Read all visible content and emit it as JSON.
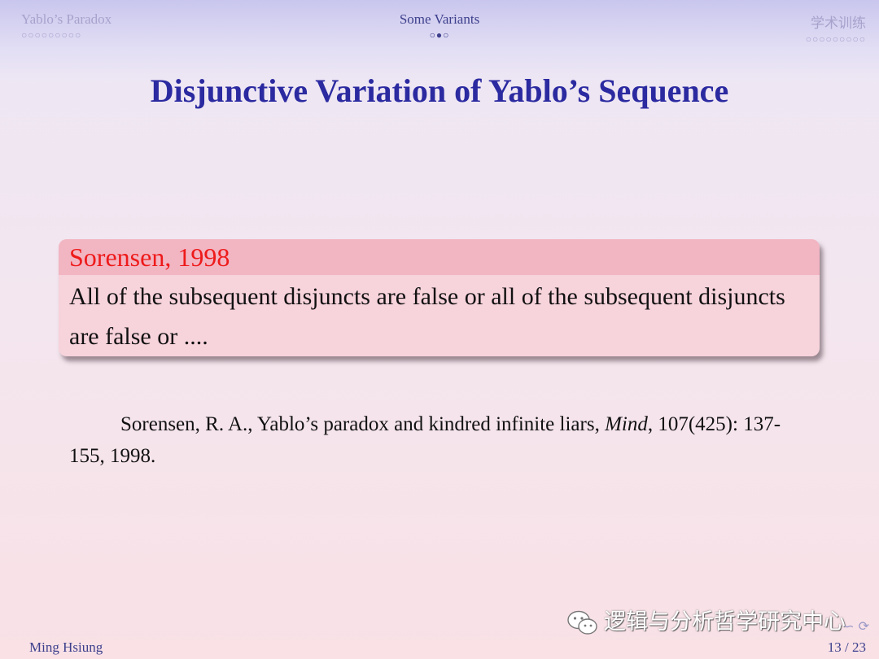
{
  "header": {
    "left_section": "Yablo’s Paradox",
    "left_dots": "○○○○○○○○○",
    "center_section": "Some Variants",
    "center_dots": "○●○",
    "right_section": "学术训练",
    "right_dots": "○○○○○○○○○"
  },
  "slide": {
    "title": "Disjunctive Variation of Yablo’s Sequence",
    "block_title": "Sorensen, 1998",
    "block_body": "All of the subsequent disjuncts are false or all of the subsequent disjuncts are false or ....",
    "reference": {
      "authors": "Sorensen, R. A., Yablo’s paradox and kindred infinite liars, ",
      "journal": "Mind",
      "rest": ", 107(425): 137-155, 1998."
    }
  },
  "watermark": {
    "text": "逻辑与分析哲学研究中心",
    "icon": "wechat-icon"
  },
  "footer": {
    "author": "Ming Hsiung",
    "page": "13 / 23",
    "nav_symbols": "∽ ⟳"
  }
}
